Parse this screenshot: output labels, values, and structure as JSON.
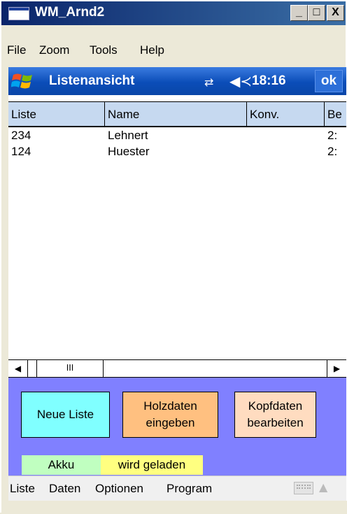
{
  "window": {
    "title": "WM_Arnd2",
    "controls": [
      "_",
      "□",
      "X"
    ]
  },
  "menubar": {
    "items": [
      "File",
      "Zoom",
      "Tools",
      "Help"
    ]
  },
  "device": {
    "title": "Listenansicht",
    "time": "18:16",
    "ok_label": "ok",
    "icons": [
      "windows-start-icon",
      "connectivity-icon",
      "volume-icon"
    ]
  },
  "list": {
    "columns": [
      "Liste",
      "Name",
      "Konv.",
      "Be"
    ],
    "rows": [
      {
        "liste": "234",
        "name": "Lehnert",
        "konv": "",
        "be": "2:"
      },
      {
        "liste": "124",
        "name": "Huester",
        "konv": "",
        "be": "2:"
      }
    ],
    "scroll": {
      "left": "◀",
      "thumb": "III",
      "right": "▶"
    }
  },
  "buttons": {
    "neue_liste": "Neue Liste",
    "holzdaten": "Holzdaten eingeben",
    "kopfdaten": "Kopfdaten bearbeiten"
  },
  "status": {
    "akku": "Akku",
    "message": "wird geladen"
  },
  "softbar": {
    "items": [
      "Liste",
      "Daten",
      "Optionen",
      "Program"
    ]
  },
  "colors": {
    "titlebar": "#0a246a",
    "pda_bar": "#0b4db8",
    "list_header": "#c6d9f0",
    "panel": "#8080ff",
    "neue_liste_bg": "#80ffff",
    "holzdaten_bg": "#ffc080",
    "kopfdaten_bg": "#ffdcc0",
    "akku_bg": "#c0ffc0",
    "status_bg": "#ffff80"
  }
}
